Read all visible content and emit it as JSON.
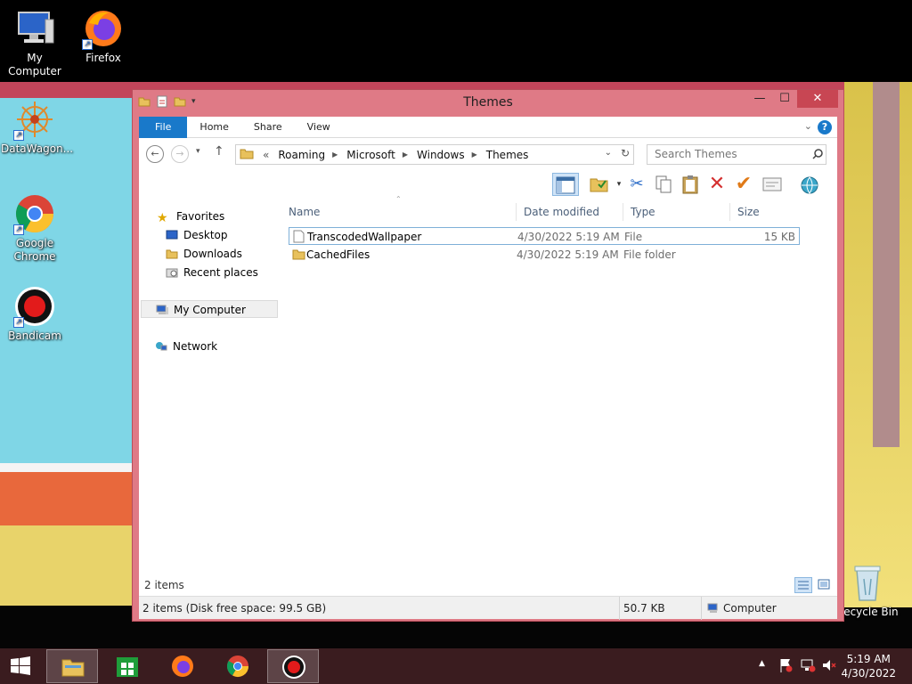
{
  "desktop": {
    "icons": [
      {
        "label": "My Computer"
      },
      {
        "label": "Firefox"
      },
      {
        "label": "DataWagon..."
      },
      {
        "label": "Google Chrome"
      },
      {
        "label": "Bandicam"
      },
      {
        "label": "Recycle Bin"
      }
    ]
  },
  "window": {
    "title": "Themes",
    "controls": {
      "minimize": "—",
      "maximize": "☐",
      "close": "✕"
    },
    "ribbon_tabs": [
      "File",
      "Home",
      "Share",
      "View"
    ],
    "help": "?",
    "address": {
      "prefix": "«",
      "crumbs": [
        "Roaming",
        "Microsoft",
        "Windows",
        "Themes"
      ]
    },
    "search_placeholder": "Search Themes",
    "nav": {
      "favorites": "Favorites",
      "desktop": "Desktop",
      "downloads": "Downloads",
      "recent": "Recent places",
      "my_computer": "My Computer",
      "network": "Network"
    },
    "columns": [
      "Name",
      "Date modified",
      "Type",
      "Size"
    ],
    "files": [
      {
        "name": "TranscodedWallpaper",
        "date": "4/30/2022 5:19 AM",
        "type": "File",
        "size": "15 KB"
      },
      {
        "name": "CachedFiles",
        "date": "4/30/2022 5:19 AM",
        "type": "File folder",
        "size": ""
      }
    ],
    "item_count": "2 items",
    "status": {
      "summary": "2 items (Disk free space: 99.5 GB)",
      "size": "50.7 KB",
      "location": "Computer"
    }
  },
  "taskbar": {
    "time": "5:19 AM",
    "date": "4/30/2022"
  },
  "colors": {
    "window_frame": "#df7a86",
    "accent_blue": "#1979ca",
    "close_red": "#c84653",
    "taskbar": "#3a1c1f"
  }
}
